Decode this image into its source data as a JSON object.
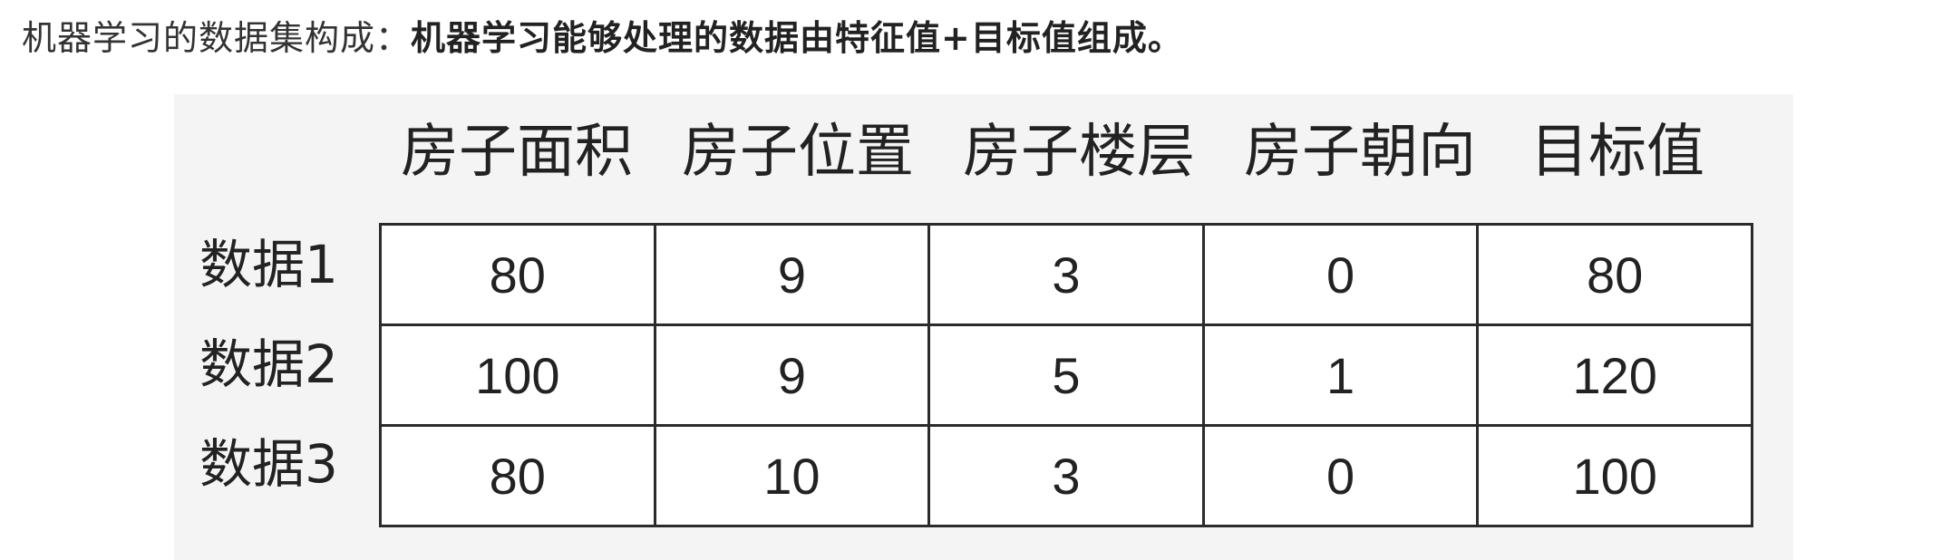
{
  "intro": {
    "lead": "机器学习的数据集构成：",
    "emphasis": "机器学习能够处理的数据由特征值+目标值组成。"
  },
  "table": {
    "headers": [
      "房子面积",
      "房子位置",
      "房子楼层",
      "房子朝向",
      "目标值"
    ],
    "row_labels": [
      "数据1",
      "数据2",
      "数据3"
    ],
    "rows": [
      [
        "80",
        "9",
        "3",
        "0",
        "80"
      ],
      [
        "100",
        "9",
        "5",
        "1",
        "120"
      ],
      [
        "80",
        "10",
        "3",
        "0",
        "100"
      ]
    ]
  }
}
